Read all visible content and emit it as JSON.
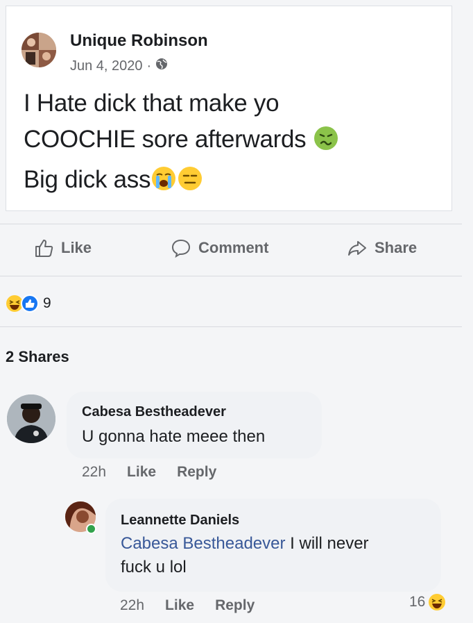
{
  "post": {
    "author": "Unique Robinson",
    "date": "Jun 4, 2020",
    "separator": "·",
    "audience_icon": "globe-icon",
    "text_line1": "I Hate dick that make yo",
    "text_line2": "COOCHIE sore afterwards",
    "text_line3": "Big dick ass",
    "emojis": [
      "nauseated-face-icon",
      "loudly-crying-face-icon",
      "expressionless-face-icon"
    ]
  },
  "actions": {
    "like": "Like",
    "comment": "Comment",
    "share": "Share"
  },
  "reactions": {
    "icons": [
      "haha-reaction-icon",
      "like-reaction-icon"
    ],
    "count": "9"
  },
  "shares_label": "2 Shares",
  "comments": [
    {
      "name": "Cabesa Bestheadever",
      "text": "U gonna hate meee then",
      "time": "22h",
      "like": "Like",
      "reply": "Reply"
    },
    {
      "name": "Leannette Daniels",
      "mention": "Cabesa Bestheadever",
      "text_rest": " I will never",
      "text_line2": "fuck u lol",
      "time": "22h",
      "like": "Like",
      "reply": "Reply",
      "reaction_count": "16",
      "reaction_icon": "haha-reaction-icon"
    }
  ],
  "colors": {
    "link_blue": "#385898",
    "muted": "#65676b",
    "like_blue": "#1877f2",
    "bubble_bg": "#f0f2f5"
  }
}
